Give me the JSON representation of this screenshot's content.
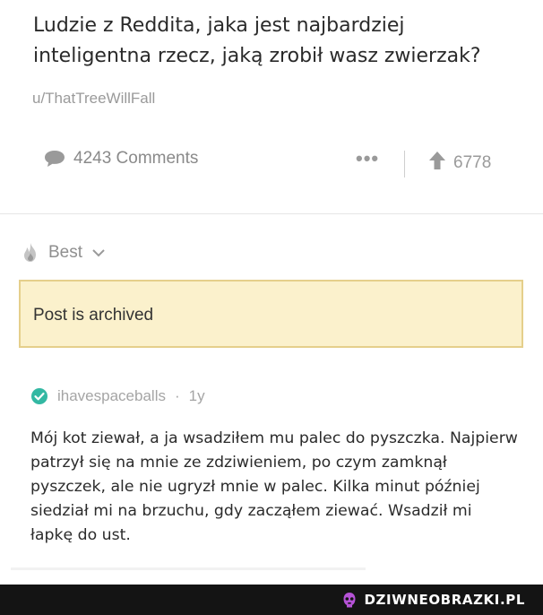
{
  "post": {
    "title": "Ludzie z Reddita, jaka jest najbardziej\ninteligentna rzecz, jaką zrobił wasz zwierzak?",
    "author": "u/ThatTreeWillFall",
    "comments_label": "4243 Comments",
    "more_label": "•••",
    "upvotes": "6778"
  },
  "sort": {
    "label": "Best"
  },
  "notice": {
    "text": "Post is archived"
  },
  "comment": {
    "author": "ihavespaceballs",
    "separator": "·",
    "age": "1y",
    "text": "Mój kot ziewał, a ja wsadziłem mu palec do pyszczka. Najpierw patrzył się na mnie ze zdziwieniem, po czym zamknął pyszczek, ale nie ugryzł mnie w palec. Kilka minut później siedział mi na brzuchu, gdy zacząłem ziewać. Wsadził mi łapkę do ust."
  },
  "footer": {
    "watermark_text": "DZIWNEOBRAZKI.PL"
  },
  "colors": {
    "verified_badge": "#33b8a3",
    "archived_bg": "#fbf1cc",
    "archived_border": "#e5cf8b",
    "muted_text": "#9a9a9a",
    "footer_bg": "#141414",
    "watermark_accent": "#b552d6"
  },
  "icons": {
    "comments": "speech-bubble-icon",
    "upvote": "up-arrow-icon",
    "sort": "flame-icon",
    "sort_toggle": "chevron-down-icon",
    "verified": "check-circle-icon",
    "watermark": "watermark-logo-icon"
  }
}
